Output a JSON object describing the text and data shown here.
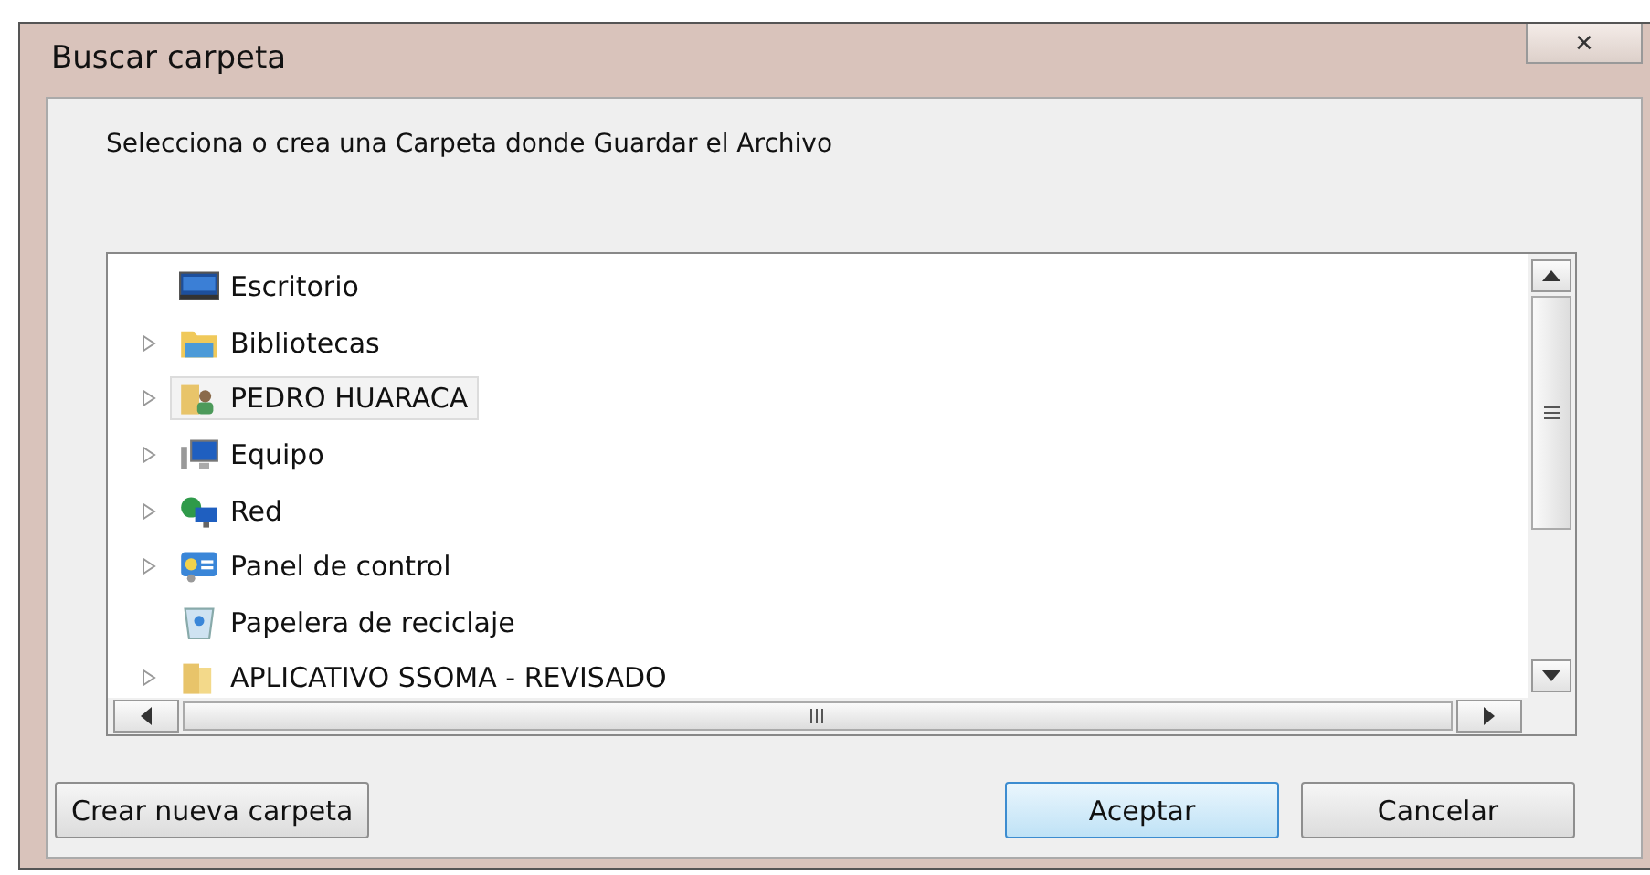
{
  "window": {
    "title": "Buscar carpeta",
    "close_label": "✕"
  },
  "message": "Selecciona o crea una Carpeta donde Guardar el Archivo",
  "tree": [
    {
      "label": "Escritorio",
      "expandable": false,
      "selected": false,
      "children": [
        {
          "label": "Bibliotecas",
          "expandable": true,
          "selected": false
        },
        {
          "label": "PEDRO HUARACA",
          "expandable": true,
          "selected": true
        },
        {
          "label": "Equipo",
          "expandable": true,
          "selected": false
        },
        {
          "label": "Red",
          "expandable": true,
          "selected": false
        },
        {
          "label": "Panel de control",
          "expandable": true,
          "selected": false
        },
        {
          "label": "Papelera de reciclaje",
          "expandable": false,
          "selected": false
        },
        {
          "label": "APLICATIVO SSOMA - REVISADO",
          "expandable": true,
          "selected": false
        }
      ]
    }
  ],
  "buttons": [
    {
      "label": "Crear nueva carpeta",
      "kind": "secondary",
      "default": false
    },
    {
      "label": "Aceptar",
      "kind": "primary",
      "default": true
    },
    {
      "label": "Cancelar",
      "kind": "primary",
      "default": false
    }
  ]
}
